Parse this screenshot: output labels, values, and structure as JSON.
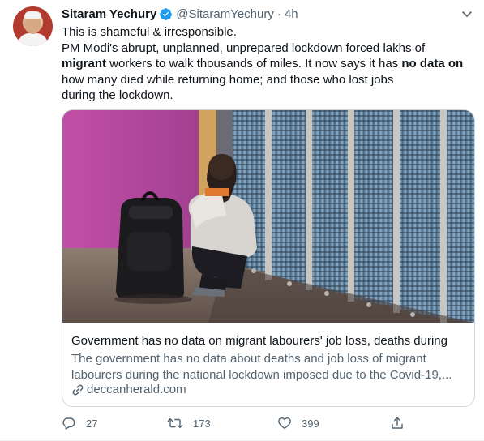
{
  "tweet": {
    "author": {
      "name": "Sitaram Yechury",
      "handle": "@SitaramYechury",
      "verified": true
    },
    "separator": "·",
    "time": "4h",
    "text_lines": [
      {
        "parts": [
          {
            "text": "This is shameful & irresponsible.",
            "bold": false
          }
        ]
      },
      {
        "parts": [
          {
            "text": "PM Modi's abrupt, unplanned, unprepared lockdown forced lakhs of",
            "bold": false
          }
        ]
      },
      {
        "parts": [
          {
            "text": "migrant",
            "bold": true
          },
          {
            "text": " workers to walk thousands of miles. It now says it has ",
            "bold": false
          },
          {
            "text": "no data on",
            "bold": true
          }
        ]
      },
      {
        "parts": [
          {
            "text": "how many died while returning home; and those who lost jobs",
            "bold": false
          }
        ]
      },
      {
        "parts": [
          {
            "text": "during the lockdown.",
            "bold": false
          }
        ]
      }
    ],
    "card": {
      "title": "Government has no data on migrant labourers' job loss, deaths during",
      "description_lines": [
        "The government has no data about deaths and job loss of migrant",
        "labourers during the national lockdown imposed due to the Covid-19,..."
      ],
      "domain": "deccanherald.com"
    },
    "actions": {
      "reply_count": "27",
      "retweet_count": "173",
      "like_count": "399"
    }
  },
  "colors": {
    "text_primary": "#0f1419",
    "text_secondary": "#536471",
    "verified_blue": "#1d9bf0",
    "border": "#cfd9de"
  },
  "icons": [
    "verified-badge-icon",
    "more-chevron-icon",
    "link-icon",
    "reply-icon",
    "retweet-icon",
    "like-icon",
    "share-icon"
  ]
}
